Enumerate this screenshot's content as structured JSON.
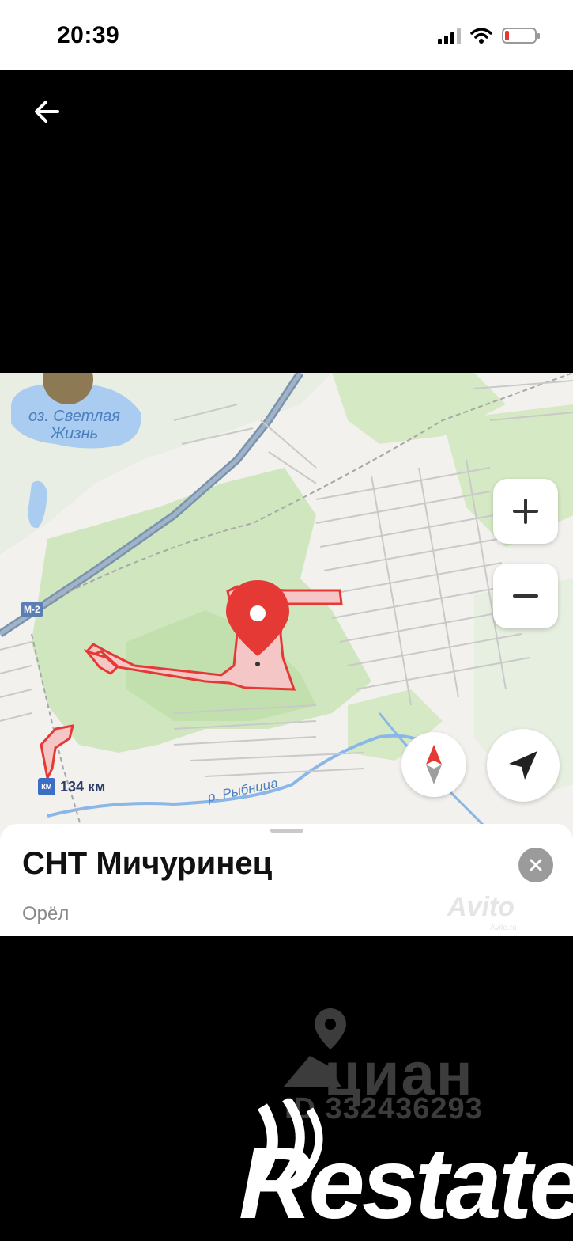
{
  "status_bar": {
    "time": "20:39",
    "signal_icon": "cellular-signal-icon",
    "wifi_icon": "wifi-icon",
    "battery_icon": "battery-low-icon",
    "battery_color": "#e53935"
  },
  "nav": {
    "back_icon": "arrow-left-icon"
  },
  "map": {
    "lake_label_line1": "оз. Светлая",
    "lake_label_line2": "Жизнь",
    "river_label": "р. Рыбница",
    "road_label": "М-2",
    "km_icon_text": "км",
    "km_label": "134 км",
    "pin_color": "#e53935",
    "zoom_in_label": "+",
    "zoom_out_label": "−",
    "compass_icon": "compass-icon",
    "locate_icon": "navigation-arrow-icon"
  },
  "place": {
    "title": "СНТ Мичуринец",
    "city": "Орёл",
    "close_icon": "close-icon"
  },
  "watermarks": {
    "avito": "Avito",
    "avito_sub": "Avito.ru",
    "cian_text": "циан",
    "cian_id": "ID 332436293",
    "restate": "Restate"
  }
}
